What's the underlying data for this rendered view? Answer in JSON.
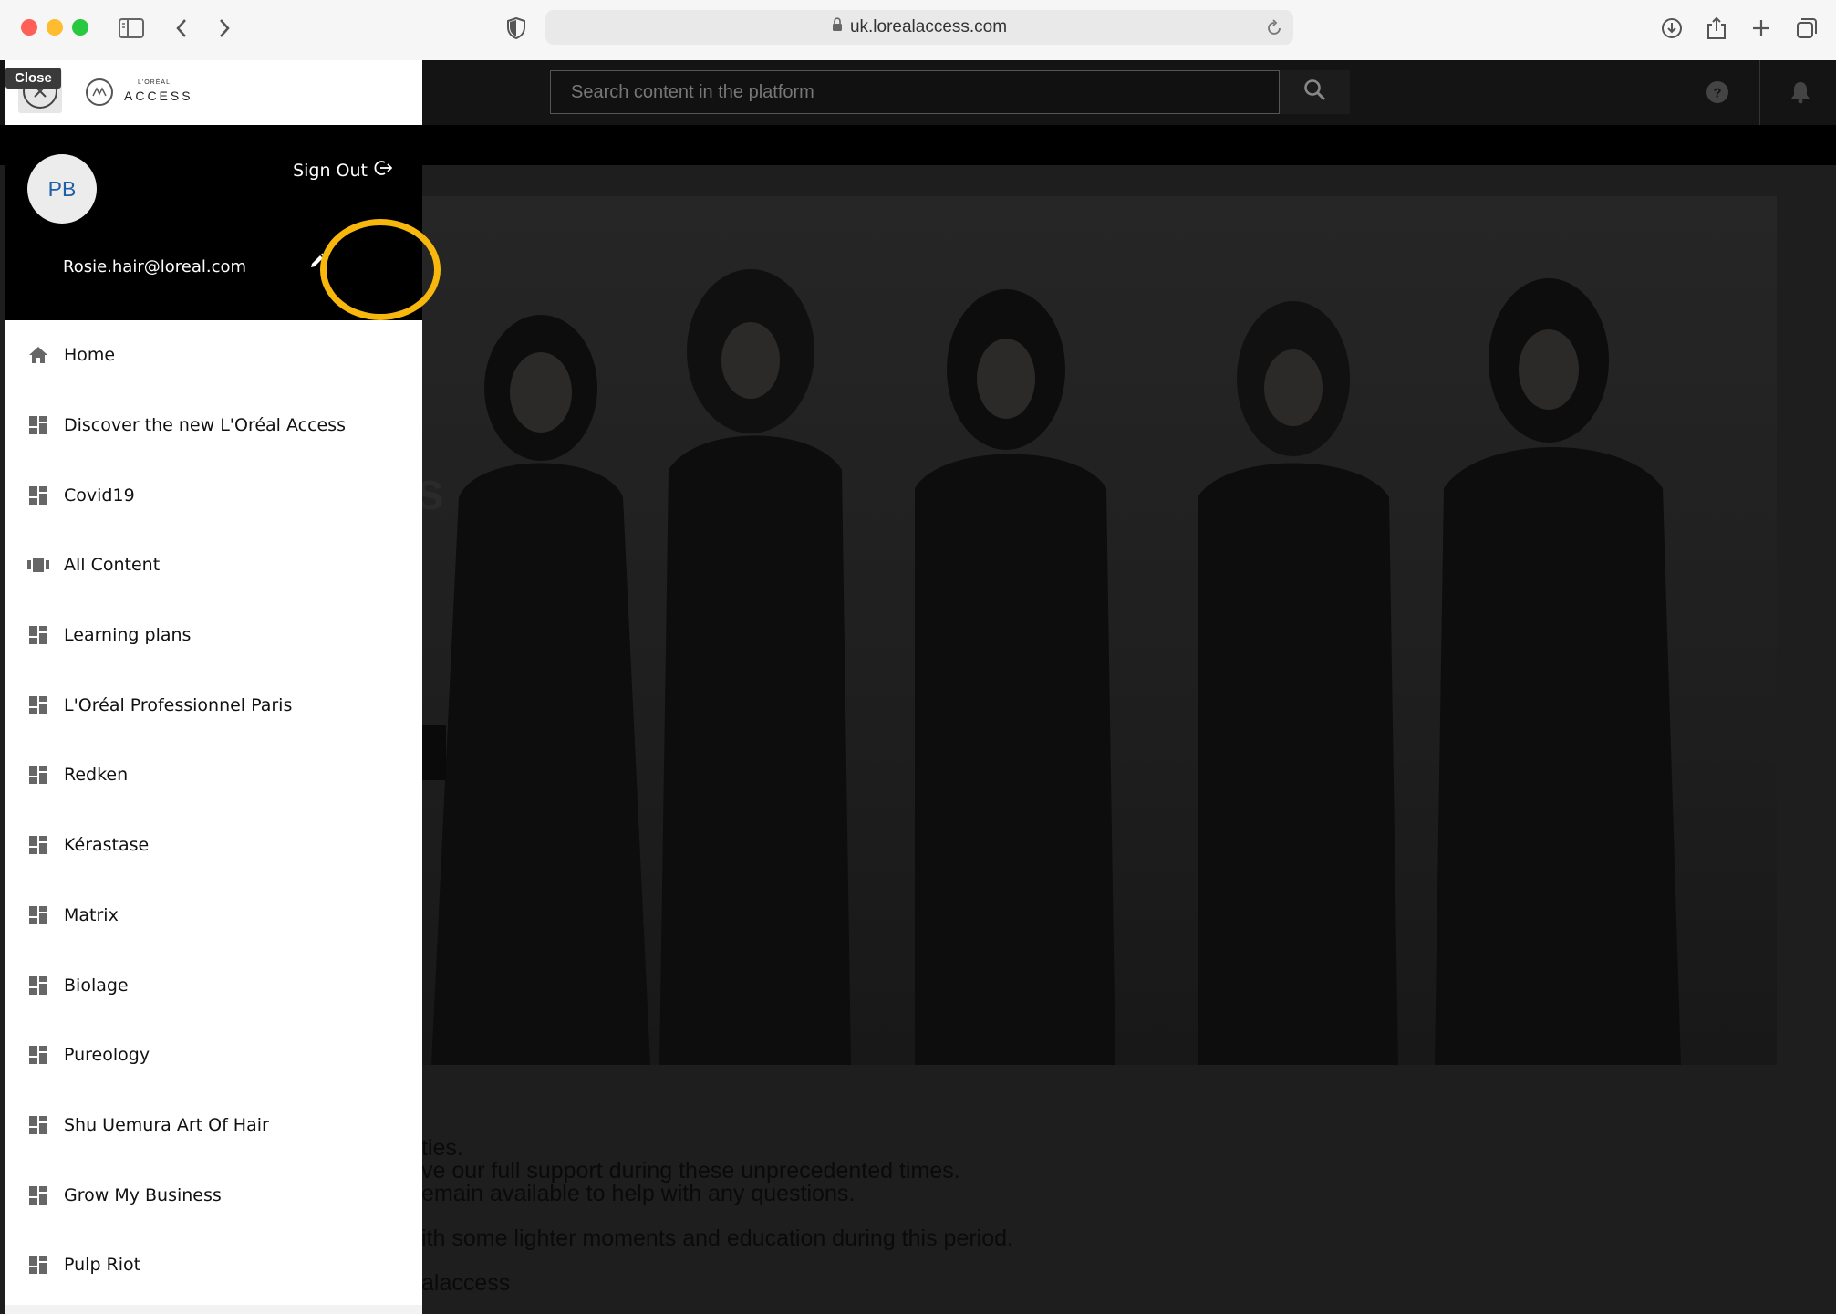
{
  "browser": {
    "url": "uk.lorealaccess.com"
  },
  "site": {
    "search_placeholder": "Search content in the platform"
  },
  "drawer": {
    "tooltip": "Close",
    "logo_small": "L'ORÉAL",
    "logo_text": "ACCESS",
    "avatar_initials": "PB",
    "sign_out_label": "Sign Out",
    "email": "Rosie.hair@loreal.com",
    "menu": [
      {
        "label": "Home",
        "icon": "home-icon"
      },
      {
        "label": "Discover the new L'Oréal Access",
        "icon": "dashboard-icon"
      },
      {
        "label": "Covid19",
        "icon": "dashboard-icon"
      },
      {
        "label": "All Content",
        "icon": "carousel-icon"
      },
      {
        "label": "Learning plans",
        "icon": "dashboard-icon"
      },
      {
        "label": "L'Oréal Professionnel Paris",
        "icon": "dashboard-icon"
      },
      {
        "label": "Redken",
        "icon": "dashboard-icon"
      },
      {
        "label": "Kérastase",
        "icon": "dashboard-icon"
      },
      {
        "label": "Matrix",
        "icon": "dashboard-icon"
      },
      {
        "label": "Biolage",
        "icon": "dashboard-icon"
      },
      {
        "label": "Pureology",
        "icon": "dashboard-icon"
      },
      {
        "label": "Shu Uemura Art Of Hair",
        "icon": "dashboard-icon"
      },
      {
        "label": "Grow My Business",
        "icon": "dashboard-icon"
      },
      {
        "label": "Pulp Riot",
        "icon": "dashboard-icon"
      }
    ]
  },
  "background_page": {
    "hero_fragment": "s",
    "text_lines": [
      "ties.",
      "ve our full support during these unprecedented times.",
      "emain available to help with any questions.",
      "ith some lighter moments and education during this period.",
      "alaccess"
    ]
  },
  "colors": {
    "highlight_ring": "#f7b70d",
    "avatar_text": "#1f5fa8"
  }
}
